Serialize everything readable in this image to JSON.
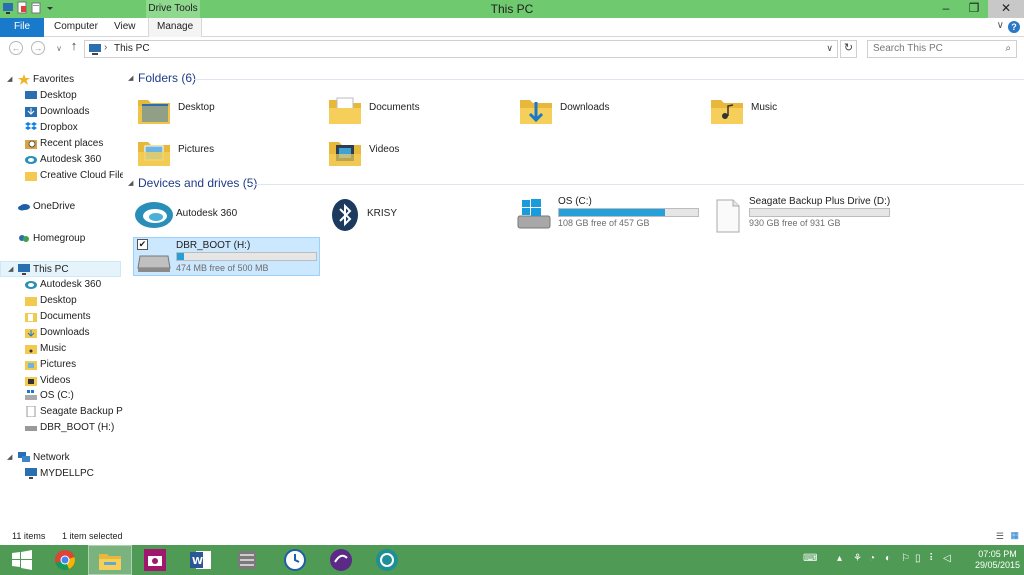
{
  "window": {
    "title": "This PC",
    "context_tab": "Drive Tools",
    "controls": {
      "minimize": "–",
      "maximize": "❐",
      "close": "✕"
    }
  },
  "ribbon": {
    "tabs": [
      "File",
      "Computer",
      "View",
      "Manage"
    ],
    "expand": "∨",
    "help": "?"
  },
  "nav": {
    "back": "←",
    "forward": "→",
    "recent": "∨",
    "up": "↑",
    "address_sep": "›",
    "address": "This PC",
    "address_dropdown": "∨",
    "refresh": "↻",
    "search_placeholder": "Search This PC",
    "search_icon": "⌕"
  },
  "sidebar": {
    "favorites": {
      "label": "Favorites",
      "items": [
        "Desktop",
        "Downloads",
        "Dropbox",
        "Recent places",
        "Autodesk 360",
        "Creative Cloud Files"
      ]
    },
    "onedrive": "OneDrive",
    "homegroup": "Homegroup",
    "thispc": {
      "label": "This PC",
      "items": [
        "Autodesk 360",
        "Desktop",
        "Documents",
        "Downloads",
        "Music",
        "Pictures",
        "Videos",
        "OS (C:)",
        "Seagate Backup Plus Drive (D:)",
        "DBR_BOOT (H:)"
      ]
    },
    "network": {
      "label": "Network",
      "items": [
        "MYDELLPC"
      ]
    }
  },
  "content": {
    "folders_header": "Folders (6)",
    "folders": [
      "Desktop",
      "Documents",
      "Downloads",
      "Music",
      "Pictures",
      "Videos"
    ],
    "devices_header": "Devices and drives (5)",
    "devices": [
      {
        "name": "Autodesk 360"
      },
      {
        "name": "KRISY"
      },
      {
        "name": "OS (C:)",
        "free": "108 GB free of 457 GB",
        "used_fraction": 0.76
      },
      {
        "name": "Seagate Backup Plus Drive (D:)",
        "free": "930 GB free of 931 GB",
        "used_fraction": 0.0
      },
      {
        "name": "DBR_BOOT (H:)",
        "free": "474 MB free of 500 MB",
        "used_fraction": 0.05,
        "selected": true,
        "checkbox": "✔"
      }
    ]
  },
  "status": {
    "count": "11 items",
    "selected": "1 item selected",
    "view_details": "☰",
    "view_tiles": "▦"
  },
  "taskbar": {
    "apps": [
      "start",
      "chrome",
      "file-explorer",
      "camera",
      "word",
      "unknown-app",
      "clock-app",
      "music-app",
      "autodesk-app"
    ],
    "tray_icons": [
      "⌨",
      "▴",
      "⚘",
      "◔",
      "◐",
      "⚐",
      "▯",
      "⠇",
      "◁",
      "■"
    ],
    "time": "07:05 PM",
    "date": "29/05/2015"
  },
  "colors": {
    "titlebar": "#6fc96f",
    "file_tab": "#1979ca",
    "taskbar": "#4f9a55",
    "folder_yellow": "#f3c94f",
    "progress_fill": "#26a0da",
    "selection": "#cce8ff"
  }
}
